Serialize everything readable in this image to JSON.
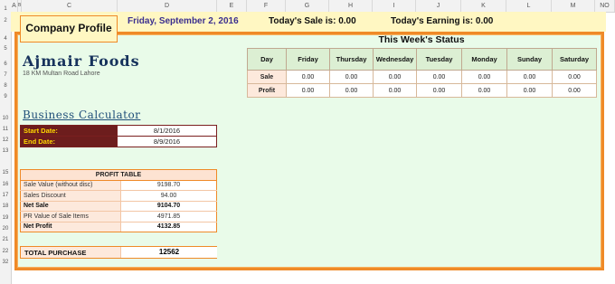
{
  "sheet": {
    "columns": [
      "A",
      "B",
      "C",
      "D",
      "E",
      "F",
      "G",
      "H",
      "I",
      "J",
      "K",
      "L",
      "M",
      "NO"
    ],
    "rows": [
      "1",
      "2",
      "4",
      "5",
      "6",
      "7",
      "8",
      "9",
      "10",
      "11",
      "12",
      "13",
      "15",
      "16",
      "17",
      "18",
      "19",
      "20",
      "21",
      "22",
      "32"
    ]
  },
  "top_bar": {
    "date": "Friday, September 2, 2016",
    "todays_sale": "Today's Sale is: 0.00",
    "todays_earning": "Today's Earning is: 0.00"
  },
  "profile_button": "Company Profile",
  "company": {
    "name": "Ajmair Foods",
    "address": "18 KM Multan Road Lahore"
  },
  "calculator": {
    "title": "Business Calculator",
    "start_label": "Start Date:",
    "start_value": "8/1/2016",
    "end_label": "End Date:",
    "end_value": "8/9/2016"
  },
  "profit_table": {
    "header": "PROFIT TABLE",
    "rows": [
      {
        "label": "Sale Value (without disc)",
        "value": "9198.70"
      },
      {
        "label": "Sales Discount",
        "value": "94.00"
      },
      {
        "label": "Net Sale",
        "value": "9104.70"
      },
      {
        "label": "PR Value of Sale Items",
        "value": "4971.85"
      },
      {
        "label": "Net Profit",
        "value": "4132.85"
      }
    ]
  },
  "total_purchase": {
    "label": "TOTAL PURCHASE",
    "value": "12562"
  },
  "week_status": {
    "title": "This Week's Status",
    "headers": [
      "Day",
      "Friday",
      "Thursday",
      "Wednesday",
      "Tuesday",
      "Monday",
      "Sunday",
      "Saturday"
    ],
    "rows": [
      {
        "label": "Sale",
        "values": [
          "0.00",
          "0.00",
          "0.00",
          "0.00",
          "0.00",
          "0.00",
          "0.00"
        ]
      },
      {
        "label": "Profit",
        "values": [
          "0.00",
          "0.00",
          "0.00",
          "0.00",
          "0.00",
          "0.00",
          "0.00"
        ]
      }
    ]
  },
  "colors": {
    "accent_orange": "#ef8a28",
    "panel_green": "#e9fbe9",
    "top_bar_yellow": "#fff7c2",
    "date_label_bg": "#6d1d1d",
    "date_label_text": "#ffd800",
    "title_navy": "#16325c"
  }
}
